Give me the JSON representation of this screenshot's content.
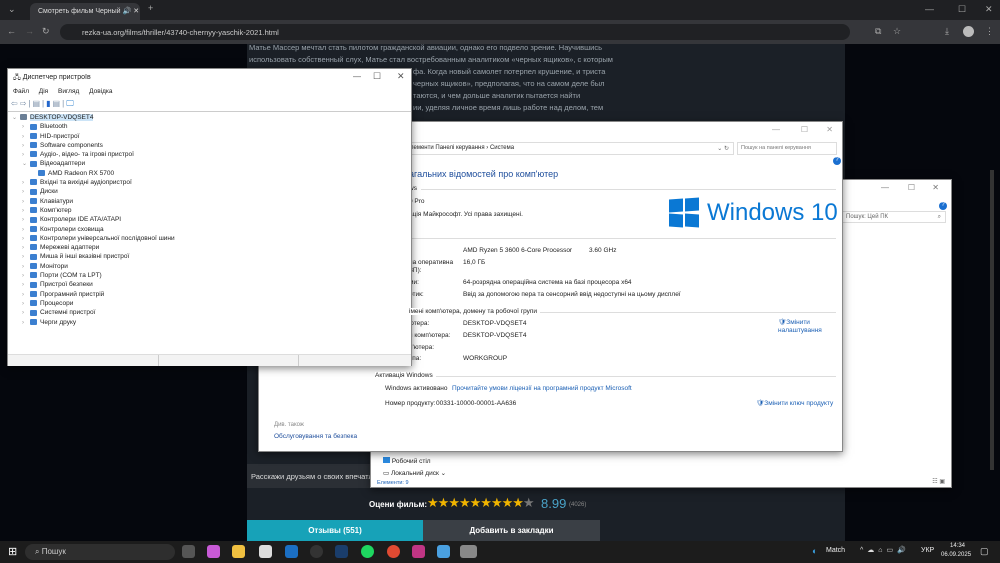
{
  "browser": {
    "tab_title": "Смотреть фильм Черный",
    "url": "rezka-ua.org/films/thriller/43740-chernyy-yaschik-2021.html"
  },
  "page": {
    "description_lines": [
      "Матье Массер мечтал стать пилотом гражданской авиации, однако его подвело зрение. Научившись",
      "использовать собственный слух, Матье стал востребованным аналитиком «черных ящиков», с которым",
      "фа. Когда новый самолет потерпел крушение, и триста",
      "черных ящиков», предполагая, что на самом деле был",
      "таются, и чем дольше аналитик пытается найти",
      "ии, уделяя личное время лишь работе над делом, тем"
    ],
    "share_text": "Расскажи друзьям о своих впечатл",
    "rating_label": "Оцени фильм:",
    "rating_value": "8.99",
    "rating_fraction": 0.9,
    "rating_count": "(4026)",
    "reviews_button": "Отзывы (551)",
    "bookmark_button": "Добавить в закладки"
  },
  "device_manager": {
    "title": "Диспетчер пристроїв",
    "menu": [
      "Файл",
      "Дія",
      "Вигляд",
      "Довідка"
    ],
    "root": "DESKTOP-VDQSET4",
    "items": [
      {
        "label": "Bluetooth",
        "expanded": false
      },
      {
        "label": "HID-пристрої",
        "expanded": false
      },
      {
        "label": "Software components",
        "expanded": false
      },
      {
        "label": "Аудіо-, відео- та ігрові пристрої",
        "expanded": false
      },
      {
        "label": "Відеоадаптери",
        "expanded": true
      },
      {
        "label": "AMD Radeon RX 5700",
        "child": true
      },
      {
        "label": "Вхідні та вихідні аудіопристрої",
        "expanded": false
      },
      {
        "label": "Диски",
        "expanded": false
      },
      {
        "label": "Клавіатури",
        "expanded": false
      },
      {
        "label": "Комп'ютер",
        "expanded": false
      },
      {
        "label": "Контролери IDE ATA/ATAPI",
        "expanded": false
      },
      {
        "label": "Контролери сховища",
        "expanded": false
      },
      {
        "label": "Контролери універсальної послідовної шини",
        "expanded": false
      },
      {
        "label": "Мережеві адаптери",
        "expanded": false
      },
      {
        "label": "Миша й інші вказівні пристрої",
        "expanded": false
      },
      {
        "label": "Монітори",
        "expanded": false
      },
      {
        "label": "Порти (COM та LPT)",
        "expanded": false
      },
      {
        "label": "Пристрої безпеки",
        "expanded": false
      },
      {
        "label": "Програмний пристрій",
        "expanded": false
      },
      {
        "label": "Процесори",
        "expanded": false
      },
      {
        "label": "Системні пристрої",
        "expanded": false
      },
      {
        "label": "Черги друку",
        "expanded": false
      }
    ]
  },
  "system": {
    "breadcrumb": "лементи Панелі керування  ›  Система",
    "search_placeholder": "Пошук на панелі керування",
    "heading": "агальних відомостей про комп'ютер",
    "edition_section": "ws",
    "edition": "0 Pro",
    "copyright": "ація Майкрософт. Усі права захищені.",
    "logo_text": "Windows 10",
    "processor_label": ":",
    "processor": "AMD Ryzen 5 3600 6-Core Processor",
    "processor_speed": "3.60 GHz",
    "ram_label": "на оперативна",
    "ram_label2": "ЗП):",
    "ram": "16,0 ГБ",
    "type_label": "ми:",
    "type": "64-розрядна операційна система на базі процесора x64",
    "pen_label": "отик:",
    "pen": "Ввід за допомогою пера та сенсорний ввід недоступні на цьому дисплеї",
    "name_section": "іменi комп'ютера, домену та робочої групи",
    "name_label": "ютера:",
    "name": "DESKTOP-VDQSET4",
    "fullname_label": "я комп'ютера:",
    "fullname": "DESKTOP-VDQSET4",
    "desc_label": "п'ютера:",
    "group_label": "упа:",
    "group": "WORKGROUP",
    "change_settings": "Змінити налаштування",
    "activation_section": "Активація Windows",
    "activated": "Windows активовано",
    "license_link": "Прочитайте умови ліцензії на програмний продукт Microsoft",
    "product_id_label": "Номер продукту:",
    "product_id": "00331-10000-00001-AA636",
    "change_key": "Змінити ключ продукту",
    "see_also": "Див. також",
    "security_link": "Обслуговування та безпека"
  },
  "explorer": {
    "search_placeholder": "Пошук: Цей ПК",
    "nav": [
      "Робочий стіл",
      "Локальний диск"
    ],
    "status": "Елементи: 9"
  },
  "taskbar": {
    "search": "Пошук",
    "weather": "Match",
    "lang": "УКР",
    "time": "14:34",
    "date": "06.09.2025"
  }
}
